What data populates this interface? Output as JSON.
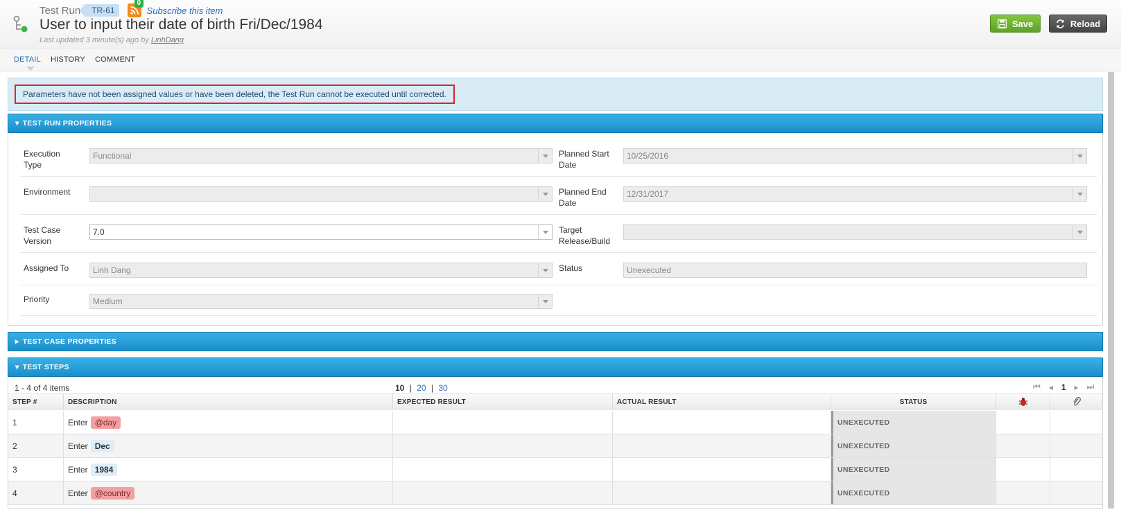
{
  "header": {
    "item_type": "Test Run",
    "item_id": "TR-61",
    "rss_count": "0",
    "subscribe_label": "Subscribe this item",
    "title": "User to input their date of birth Fri/Dec/1984",
    "updated_prefix": "Last updated 3 minute(s) ago by",
    "updated_user": "LinhDang",
    "save_label": "Save",
    "reload_label": "Reload",
    "save_color": "#6cb033",
    "reload_color": "#555555"
  },
  "tabs": [
    {
      "label": "DETAIL",
      "active": true
    },
    {
      "label": "HISTORY",
      "active": false
    },
    {
      "label": "COMMENT",
      "active": false
    }
  ],
  "alert": {
    "message": "Parameters have not been assigned values or have been deleted, the Test Run cannot be executed until corrected."
  },
  "test_run_properties": {
    "heading": "TEST RUN PROPERTIES",
    "fields": {
      "execution_type": {
        "label_line1": "Execution",
        "label_line2": "Type",
        "value": "Functional"
      },
      "environment": {
        "label_line1": "Environment",
        "label_line2": "",
        "value": ""
      },
      "test_case_version": {
        "label_line1": "Test Case",
        "label_line2": "Version",
        "value": "7.0"
      },
      "assigned_to": {
        "label_line1": "Assigned To",
        "label_line2": "",
        "value": "Linh Dang"
      },
      "priority": {
        "label_line1": "Priority",
        "label_line2": "",
        "value": "Medium"
      },
      "planned_start": {
        "label_line1": "Planned Start",
        "label_line2": "Date",
        "value": "10/25/2016"
      },
      "planned_end": {
        "label_line1": "Planned End",
        "label_line2": "Date",
        "value": "12/31/2017"
      },
      "target_release": {
        "label_line1": "Target",
        "label_line2": "Release/Build",
        "value": ""
      },
      "status": {
        "label_line1": "Status",
        "label_line2": "",
        "value": "Unexecuted"
      }
    }
  },
  "test_case_properties": {
    "heading": "TEST CASE PROPERTIES"
  },
  "test_steps": {
    "heading": "TEST STEPS",
    "items_info": "1 - 4 of 4 items",
    "page_sizes": [
      "10",
      "20",
      "30"
    ],
    "page_sep": "|",
    "current_page": "1",
    "columns": {
      "step": "STEP #",
      "description": "DESCRIPTION",
      "expected": "EXPECTED RESULT",
      "actual": "ACTUAL RESULT",
      "status": "STATUS"
    },
    "rows": [
      {
        "step": "1",
        "verb": "Enter",
        "param": "@day",
        "param_state": "bad",
        "status": "UNEXECUTED"
      },
      {
        "step": "2",
        "verb": "Enter",
        "param": "Dec",
        "param_state": "ok",
        "status": "UNEXECUTED"
      },
      {
        "step": "3",
        "verb": "Enter",
        "param": "1984",
        "param_state": "ok",
        "status": "UNEXECUTED"
      },
      {
        "step": "4",
        "verb": "Enter",
        "param": "@country",
        "param_state": "bad",
        "status": "UNEXECUTED"
      }
    ]
  },
  "icons": {
    "type": "test-run-icon",
    "rss": "rss-icon",
    "save": "save-icon",
    "reload": "reload-icon",
    "bug": "bug-icon",
    "attachment": "paperclip-icon",
    "pager_first": "first-page-icon",
    "pager_prev": "prev-page-icon",
    "pager_next": "next-page-icon",
    "pager_last": "last-page-icon"
  }
}
